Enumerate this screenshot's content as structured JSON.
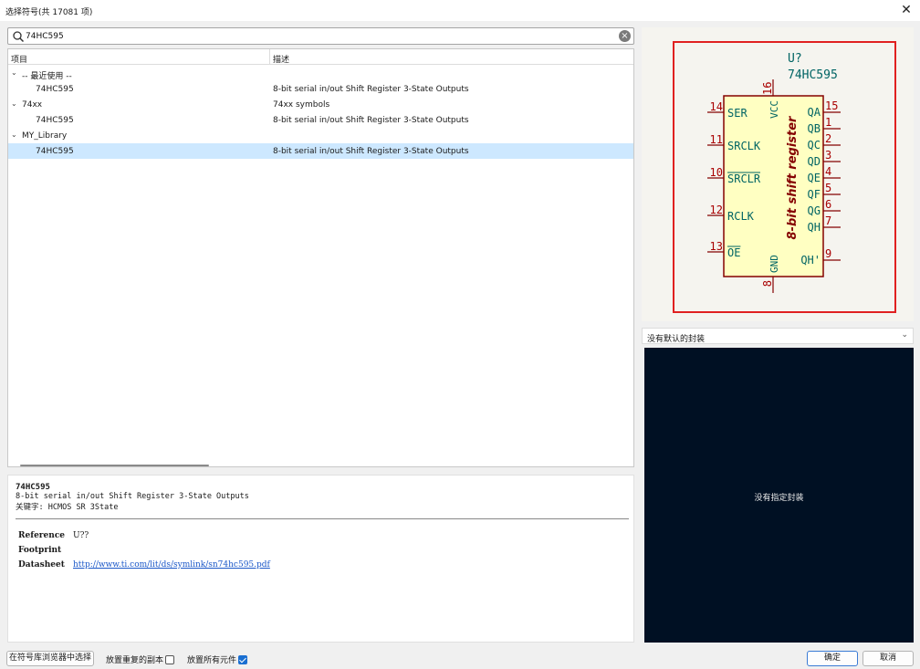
{
  "window": {
    "title": "选择符号(共 17081 项)",
    "close_glyph": "✕"
  },
  "search": {
    "value": "74HC595",
    "icon": "search-icon",
    "clear_glyph": "×"
  },
  "tree": {
    "columns": [
      "项目",
      "描述"
    ],
    "rows": [
      {
        "level": 0,
        "expanded": true,
        "name": "-- 最近使用 --",
        "desc": "",
        "selected": false
      },
      {
        "level": 1,
        "name": "74HC595",
        "desc": "8-bit serial in/out Shift Register 3-State Outputs",
        "selected": false
      },
      {
        "level": 0,
        "expanded": true,
        "name": "74xx",
        "desc": "74xx symbols",
        "selected": false
      },
      {
        "level": 1,
        "name": "74HC595",
        "desc": "8-bit serial in/out Shift Register 3-State Outputs",
        "selected": false
      },
      {
        "level": 0,
        "expanded": true,
        "name": "MY_Library",
        "desc": "",
        "selected": false
      },
      {
        "level": 1,
        "name": "74HC595",
        "desc": "8-bit serial in/out Shift Register 3-State Outputs",
        "selected": true
      }
    ]
  },
  "info": {
    "name": "74HC595",
    "description": "8-bit serial in/out Shift Register 3-State Outputs",
    "keywords": "关键字: HCMOS SR 3State",
    "reference_label": "Reference",
    "reference_value": "U??",
    "footprint_label": "Footprint",
    "footprint_value": "",
    "datasheet_label": "Datasheet",
    "datasheet_value": "http://www.ti.com/lit/ds/symlink/sn74hc595.pdf"
  },
  "symbol": {
    "ref": "U?",
    "value": "74HC595",
    "body_text": "8-bit shift register",
    "colors": {
      "border": "#e02020",
      "body_fill": "#ffffc2",
      "body_stroke": "#840000",
      "pin_name": "#006464",
      "pin_number": "#a90000",
      "ref_text": "#006464"
    },
    "left_pins": [
      {
        "num": "14",
        "name": "SER",
        "overbar": false
      },
      {
        "num": "11",
        "name": "SRCLK",
        "overbar": false
      },
      {
        "num": "10",
        "name": "SRCLR",
        "overbar": true
      },
      {
        "num": "12",
        "name": "RCLK",
        "overbar": false
      },
      {
        "num": "13",
        "name": "OE",
        "overbar": true
      }
    ],
    "right_pins": [
      {
        "num": "15",
        "name": "QA"
      },
      {
        "num": "1",
        "name": "QB"
      },
      {
        "num": "2",
        "name": "QC"
      },
      {
        "num": "3",
        "name": "QD"
      },
      {
        "num": "4",
        "name": "QE"
      },
      {
        "num": "5",
        "name": "QF"
      },
      {
        "num": "6",
        "name": "QG"
      },
      {
        "num": "7",
        "name": "QH"
      },
      {
        "num": "9",
        "name": "QH'"
      }
    ],
    "top_pin": {
      "num": "16",
      "name": "VCC"
    },
    "bottom_pin": {
      "num": "8",
      "name": "GND"
    }
  },
  "footprint": {
    "selected": "没有默认的封装",
    "empty_message": "没有指定封装"
  },
  "footer": {
    "browse_button": "在符号库浏览器中选择",
    "place_duplicates_label": "放置重复的副本",
    "place_duplicates_checked": false,
    "place_all_label": "放置所有元件",
    "place_all_checked": true,
    "ok_button": "确定",
    "cancel_button": "取消"
  }
}
